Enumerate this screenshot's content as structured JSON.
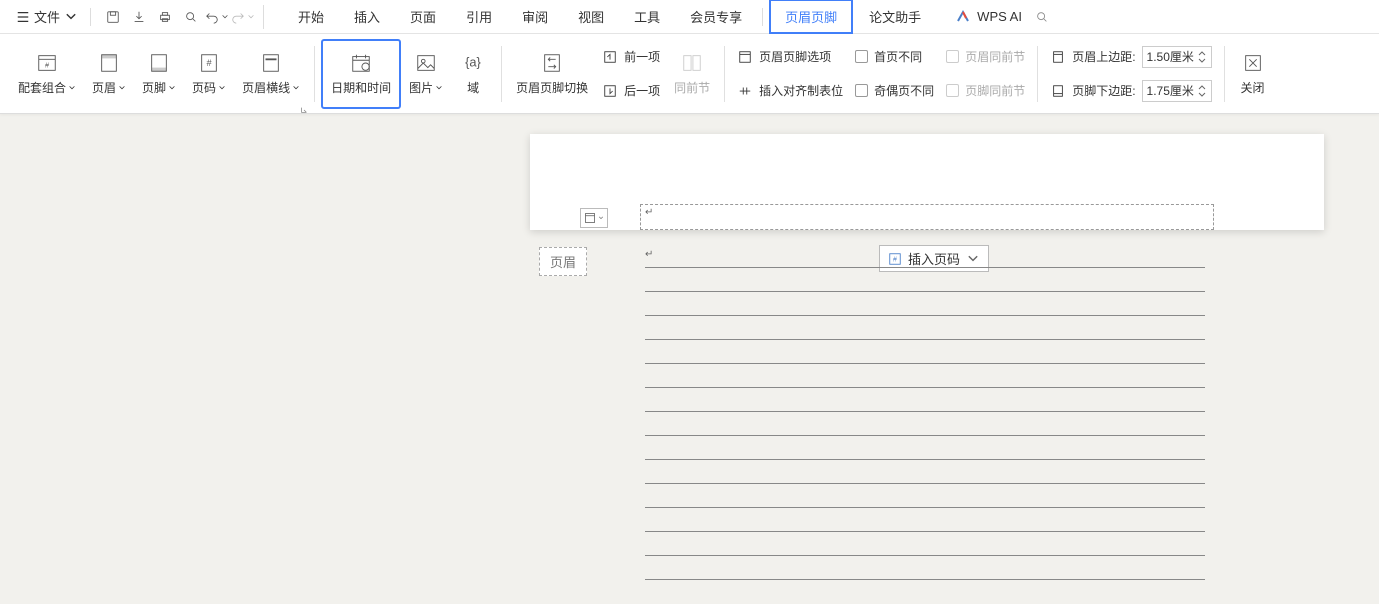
{
  "topbar": {
    "file_label": "文件"
  },
  "tabs": {
    "start": "开始",
    "insert": "插入",
    "page": "页面",
    "reference": "引用",
    "review": "审阅",
    "view": "视图",
    "tools": "工具",
    "member": "会员专享",
    "header_footer": "页眉页脚",
    "thesis": "论文助手"
  },
  "ai": {
    "label": "WPS AI"
  },
  "ribbon": {
    "combo": "配套组合",
    "header": "页眉",
    "footer": "页脚",
    "page_number": "页码",
    "header_line": "页眉横线",
    "date_time": "日期和时间",
    "picture": "图片",
    "field": "域",
    "switch": "页眉页脚切换",
    "prev": "前一项",
    "next": "后一项",
    "same_prev": "同前节",
    "options": "页眉页脚选项",
    "insert_tabs": "插入对齐制表位",
    "first_diff": "首页不同",
    "odd_even": "奇偶页不同",
    "header_same": "页眉同前节",
    "footer_same": "页脚同前节",
    "header_margin": "页眉上边距:",
    "footer_margin": "页脚下边距:",
    "header_margin_val": "1.50厘米",
    "footer_margin_val": "1.75厘米",
    "close": "关闭"
  },
  "doc": {
    "header_label": "页眉",
    "insert_page_number": "插入页码"
  }
}
